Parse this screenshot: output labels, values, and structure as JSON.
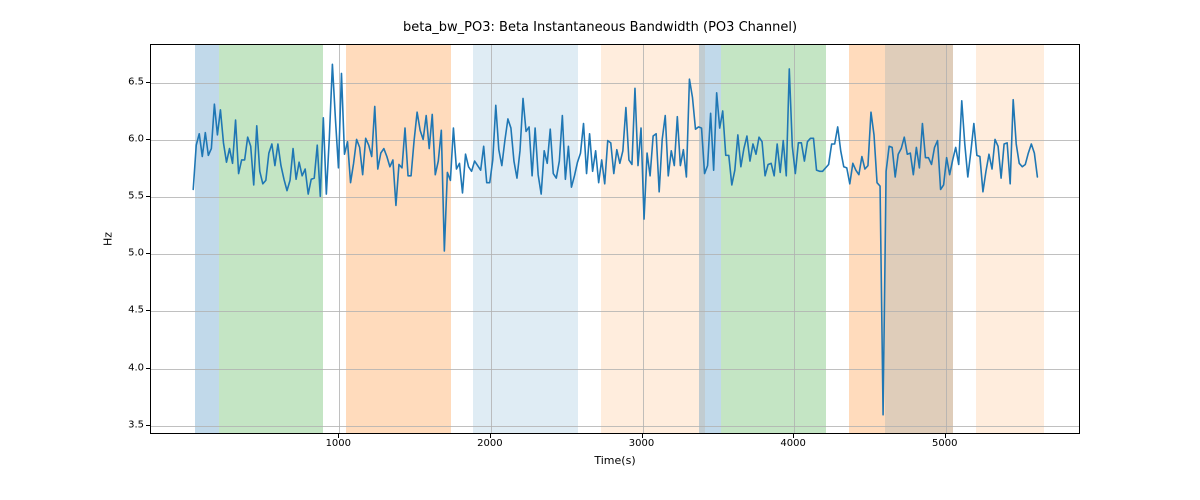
{
  "chart_data": {
    "type": "line",
    "title": "beta_bw_PO3: Beta Instantaneous Bandwidth (PO3 Channel)",
    "xlabel": "Time(s)",
    "ylabel": "Hz",
    "xlim": [
      -242,
      5892
    ],
    "ylim": [
      3.42,
      6.83
    ],
    "xticks": [
      1000,
      2000,
      3000,
      4000,
      5000
    ],
    "yticks": [
      3.5,
      4.0,
      4.5,
      5.0,
      5.5,
      6.0,
      6.5
    ],
    "bands": [
      {
        "x0": 50,
        "x1": 205,
        "color": "#1f77b4"
      },
      {
        "x0": 205,
        "x1": 895,
        "color": "#2ca02c"
      },
      {
        "x0": 1045,
        "x1": 1735,
        "color": "#ff7f0e"
      },
      {
        "x0": 1885,
        "x1": 2575,
        "color": "#1f77b4",
        "light": true
      },
      {
        "x0": 2725,
        "x1": 3415,
        "color": "#ff7f0e",
        "light": true
      },
      {
        "x0": 3370,
        "x1": 3520,
        "color": "#1f77b4"
      },
      {
        "x0": 3520,
        "x1": 4210,
        "color": "#2ca02c"
      },
      {
        "x0": 4360,
        "x1": 5050,
        "color": "#ff7f0e"
      },
      {
        "x0": 5200,
        "x1": 5650,
        "color": "#ff7f0e",
        "light": true
      }
    ],
    "bands_overlay": [
      {
        "x0": 4600,
        "x1": 5050,
        "color": "#1f77b4",
        "light": true
      }
    ],
    "line_color": "#1f77b4",
    "x": [
      37,
      57,
      77,
      97,
      117,
      137,
      157,
      177,
      197,
      217,
      237,
      257,
      277,
      297,
      317,
      337,
      357,
      377,
      397,
      417,
      437,
      457,
      477,
      497,
      517,
      537,
      557,
      577,
      597,
      617,
      637,
      657,
      677,
      697,
      717,
      737,
      757,
      777,
      797,
      817,
      837,
      857,
      877,
      897,
      917,
      937,
      957,
      977,
      997,
      1017,
      1037,
      1057,
      1077,
      1097,
      1117,
      1137,
      1157,
      1177,
      1197,
      1217,
      1237,
      1257,
      1277,
      1297,
      1317,
      1337,
      1357,
      1377,
      1397,
      1417,
      1437,
      1457,
      1477,
      1497,
      1517,
      1537,
      1557,
      1577,
      1597,
      1617,
      1637,
      1657,
      1677,
      1697,
      1717,
      1737,
      1757,
      1777,
      1797,
      1817,
      1837,
      1857,
      1877,
      1897,
      1917,
      1937,
      1957,
      1977,
      1997,
      2017,
      2037,
      2057,
      2077,
      2097,
      2117,
      2137,
      2157,
      2177,
      2197,
      2217,
      2237,
      2257,
      2277,
      2297,
      2317,
      2337,
      2357,
      2377,
      2397,
      2417,
      2437,
      2457,
      2477,
      2497,
      2517,
      2537,
      2557,
      2577,
      2597,
      2617,
      2637,
      2657,
      2677,
      2697,
      2717,
      2737,
      2757,
      2777,
      2797,
      2817,
      2837,
      2857,
      2877,
      2897,
      2917,
      2937,
      2957,
      2977,
      2997,
      3017,
      3037,
      3057,
      3077,
      3097,
      3117,
      3137,
      3157,
      3177,
      3197,
      3217,
      3237,
      3257,
      3277,
      3297,
      3317,
      3337,
      3357,
      3377,
      3397,
      3417,
      3437,
      3457,
      3477,
      3497,
      3517,
      3537,
      3557,
      3577,
      3597,
      3617,
      3637,
      3657,
      3677,
      3697,
      3717,
      3737,
      3757,
      3777,
      3797,
      3817,
      3837,
      3857,
      3877,
      3897,
      3917,
      3937,
      3957,
      3977,
      3997,
      4017,
      4037,
      4057,
      4077,
      4097,
      4117,
      4137,
      4157,
      4177,
      4197,
      4217,
      4237,
      4257,
      4277,
      4297,
      4317,
      4337,
      4357,
      4377,
      4397,
      4417,
      4437,
      4457,
      4477,
      4497,
      4517,
      4537,
      4557,
      4577,
      4597,
      4617,
      4637,
      4657,
      4677,
      4697,
      4717,
      4737,
      4757,
      4777,
      4797,
      4817,
      4837,
      4857,
      4877,
      4897,
      4917,
      4937,
      4957,
      4977,
      4997,
      5017,
      5037,
      5057,
      5077,
      5097,
      5117,
      5137,
      5157,
      5177,
      5197,
      5217,
      5237,
      5257,
      5277,
      5297,
      5317,
      5337,
      5357,
      5377,
      5397,
      5417,
      5437,
      5457,
      5477,
      5497,
      5517,
      5537,
      5557,
      5577,
      5597,
      5617
    ],
    "y": [
      5.56,
      5.95,
      6.05,
      5.85,
      6.06,
      5.86,
      5.92,
      6.31,
      6.04,
      6.26,
      5.97,
      5.8,
      5.92,
      5.79,
      6.17,
      5.7,
      5.82,
      5.82,
      6.02,
      5.94,
      5.6,
      6.12,
      5.72,
      5.61,
      5.64,
      5.88,
      5.96,
      5.77,
      5.96,
      5.77,
      5.65,
      5.55,
      5.64,
      5.92,
      5.65,
      5.8,
      5.68,
      5.74,
      5.52,
      5.65,
      5.66,
      5.95,
      5.5,
      6.19,
      5.52,
      6.02,
      6.66,
      6.18,
      5.75,
      6.58,
      5.87,
      5.98,
      5.62,
      5.79,
      6.0,
      5.93,
      5.69,
      6.01,
      5.95,
      5.85,
      6.29,
      5.74,
      5.88,
      5.92,
      5.85,
      5.76,
      5.82,
      5.42,
      5.78,
      5.75,
      6.1,
      5.68,
      5.68,
      5.99,
      6.24,
      6.08,
      6.0,
      6.21,
      5.92,
      6.22,
      5.69,
      5.81,
      6.08,
      5.02,
      5.71,
      5.64,
      6.1,
      5.74,
      5.79,
      5.53,
      5.87,
      5.76,
      5.72,
      5.81,
      5.77,
      5.73,
      5.94,
      5.62,
      5.62,
      5.82,
      6.3,
      5.91,
      5.77,
      5.99,
      6.18,
      6.1,
      5.81,
      5.66,
      5.9,
      6.36,
      6.07,
      6.11,
      5.68,
      6.1,
      5.69,
      5.52,
      5.9,
      5.79,
      6.09,
      5.7,
      5.66,
      5.81,
      6.21,
      5.65,
      5.94,
      5.58,
      5.68,
      5.8,
      5.88,
      6.14,
      5.7,
      6.05,
      5.72,
      5.9,
      5.62,
      5.82,
      5.61,
      5.99,
      5.97,
      5.7,
      5.91,
      5.79,
      5.9,
      6.28,
      5.82,
      5.78,
      6.45,
      5.77,
      6.1,
      5.3,
      5.88,
      5.68,
      6.03,
      6.05,
      5.54,
      6.0,
      6.21,
      5.68,
      5.9,
      5.77,
      6.2,
      5.77,
      5.91,
      5.67,
      6.53,
      6.37,
      6.09,
      6.11,
      6.1,
      5.7,
      5.77,
      6.23,
      5.73,
      6.41,
      6.1,
      6.25,
      5.86,
      5.86,
      5.6,
      5.73,
      6.04,
      5.76,
      5.92,
      6.03,
      5.81,
      5.96,
      5.87,
      6.02,
      5.98,
      5.68,
      5.78,
      5.79,
      5.68,
      5.96,
      5.71,
      5.99,
      5.68,
      6.62,
      5.94,
      5.7,
      5.97,
      5.97,
      5.81,
      5.98,
      6.01,
      6.01,
      5.73,
      5.72,
      5.72,
      5.75,
      5.78,
      5.96,
      5.96,
      6.11,
      5.9,
      5.76,
      5.75,
      5.61,
      5.79,
      5.73,
      5.69,
      5.85,
      5.74,
      5.77,
      6.24,
      6.04,
      5.62,
      5.59,
      3.58,
      5.72,
      5.94,
      5.93,
      5.67,
      5.87,
      5.92,
      6.02,
      5.87,
      5.88,
      5.69,
      5.93,
      5.75,
      6.14,
      5.84,
      5.84,
      5.78,
      5.93,
      5.99,
      5.56,
      5.6,
      5.84,
      5.69,
      5.82,
      5.93,
      5.78,
      6.34,
      5.96,
      5.67,
      5.89,
      6.14,
      5.86,
      5.85,
      5.54,
      5.72,
      5.87,
      5.74,
      6.0,
      5.94,
      5.66,
      5.96,
      5.97,
      5.61,
      6.35,
      5.96,
      5.79,
      5.76,
      5.78,
      5.88,
      5.96,
      5.88,
      5.67
    ]
  }
}
